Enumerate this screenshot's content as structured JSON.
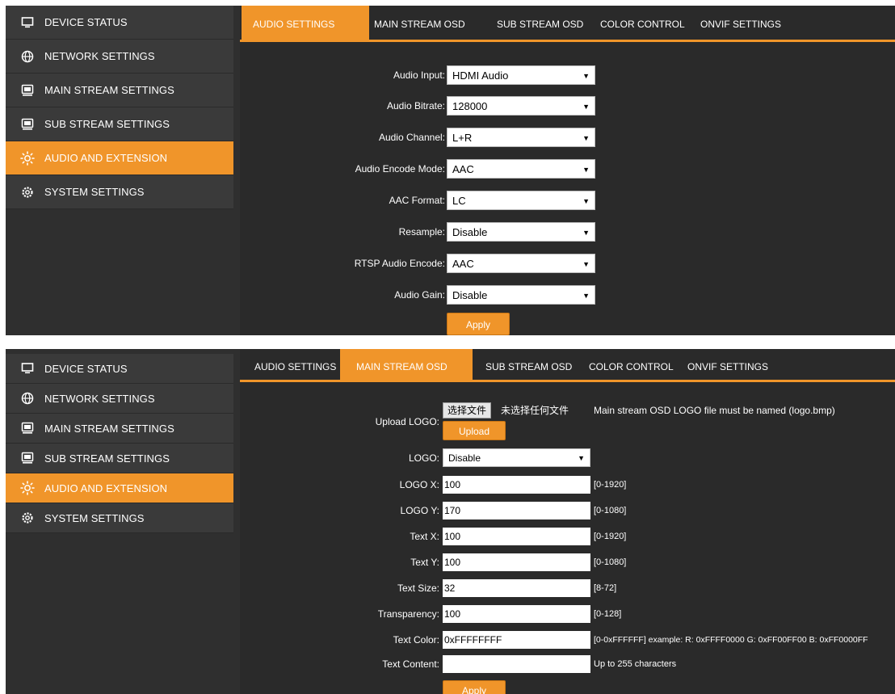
{
  "sidebar": {
    "items": [
      {
        "label": "DEVICE STATUS",
        "icon": "monitor-icon"
      },
      {
        "label": "NETWORK SETTINGS",
        "icon": "globe-icon"
      },
      {
        "label": "MAIN STREAM SETTINGS",
        "icon": "display-icon"
      },
      {
        "label": "SUB STREAM SETTINGS",
        "icon": "display-icon"
      },
      {
        "label": "AUDIO AND EXTENSION",
        "icon": "sun-icon",
        "active": true
      },
      {
        "label": "SYSTEM SETTINGS",
        "icon": "gear-icon"
      }
    ]
  },
  "tabs": [
    "AUDIO SETTINGS",
    "MAIN STREAM OSD",
    "SUB STREAM OSD",
    "COLOR CONTROL",
    "ONVIF SETTINGS"
  ],
  "audio": {
    "fields": [
      {
        "label": "Audio Input:",
        "value": "HDMI Audio"
      },
      {
        "label": "Audio Bitrate:",
        "value": "128000"
      },
      {
        "label": "Audio Channel:",
        "value": "L+R"
      },
      {
        "label": "Audio Encode Mode:",
        "value": "AAC"
      },
      {
        "label": "AAC Format:",
        "value": "LC"
      },
      {
        "label": "Resample:",
        "value": "Disable"
      },
      {
        "label": "RTSP Audio Encode:",
        "value": "AAC"
      },
      {
        "label": "Audio Gain:",
        "value": "Disable"
      }
    ],
    "apply_label": "Apply"
  },
  "osd": {
    "upload_label": "Upload LOGO:",
    "choose_file_label": "选择文件",
    "file_status": "未选择任何文件",
    "upload_note": "Main stream OSD LOGO file must be named (logo.bmp)",
    "upload_button": "Upload",
    "logo_label": "LOGO:",
    "logo_value": "Disable",
    "fields": [
      {
        "label": "LOGO X:",
        "value": "100",
        "hint": "[0-1920]"
      },
      {
        "label": "LOGO Y:",
        "value": "170",
        "hint": "[0-1080]"
      },
      {
        "label": "Text X:",
        "value": "100",
        "hint": "[0-1920]"
      },
      {
        "label": "Text Y:",
        "value": "100",
        "hint": "[0-1080]"
      },
      {
        "label": "Text Size:",
        "value": "32",
        "hint": "[8-72]"
      },
      {
        "label": "Transparency:",
        "value": "100",
        "hint": "[0-128]"
      },
      {
        "label": "Text Color:",
        "value": "0xFFFFFFFF",
        "hint": "[0-0xFFFFFF] example: R: 0xFFFF0000 G: 0xFF00FF00 B: 0xFF0000FF"
      },
      {
        "label": "Text Content:",
        "value": "",
        "hint": "Up to 255 characters"
      }
    ],
    "apply_label": "Apply"
  },
  "colors": {
    "accent": "#f0952a",
    "panel_bg": "#2f2f2f",
    "sidebar_bg": "#3a3a3a"
  }
}
